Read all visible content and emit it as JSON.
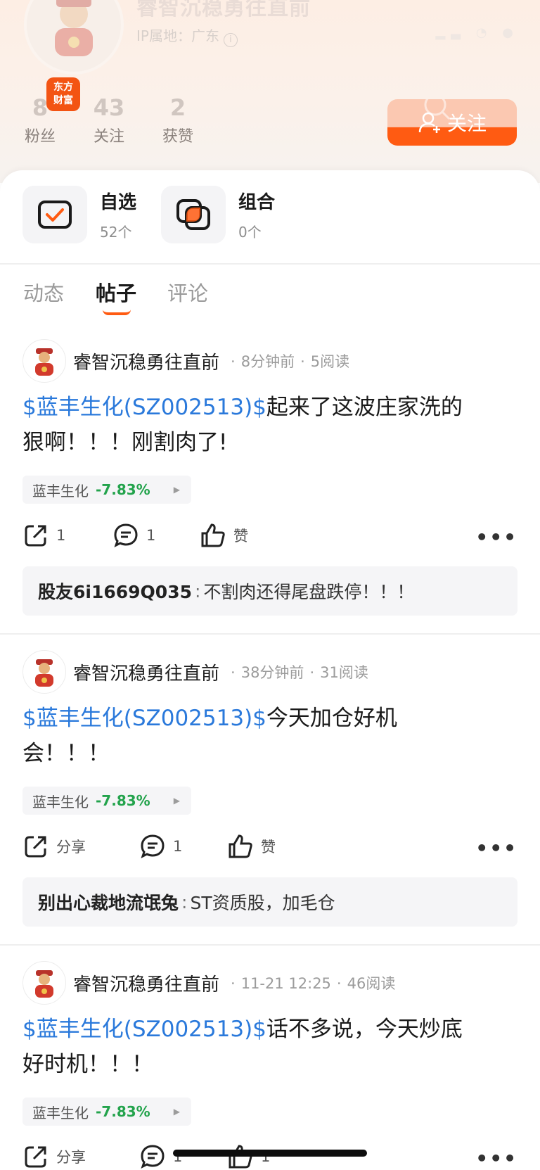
{
  "profile": {
    "name": "睿智沉稳勇往直前",
    "ip_label": "IP属地：广东",
    "info_icon": "ⓘ",
    "brand_badge": [
      "东方",
      "财富"
    ],
    "stats": [
      {
        "num": "8",
        "label": "粉丝"
      },
      {
        "num": "43",
        "label": "关注"
      },
      {
        "num": "2",
        "label": "获赞"
      }
    ],
    "follow_label": "关注"
  },
  "shortcuts": [
    {
      "title": "自选",
      "count": "52个",
      "icon": "checkbox-icon"
    },
    {
      "title": "组合",
      "count": "0个",
      "icon": "portfolio-icon"
    }
  ],
  "tabs": [
    {
      "label": "动态",
      "active": false
    },
    {
      "label": "帖子",
      "active": true
    },
    {
      "label": "评论",
      "active": false
    }
  ],
  "posts": [
    {
      "author": "睿智沉稳勇往直前",
      "time": "8分钟前",
      "reads": "5阅读",
      "tag": "$蓝丰生化(SZ002513)$",
      "text_line1": "起来了这波庄家洗的",
      "text_line2": "狠啊！！！刚割肉了!",
      "stock_name": "蓝丰生化",
      "stock_change": "-7.83%",
      "share": "1",
      "comments": "1",
      "like": "赞",
      "comment_user": "股友6i1669Q035",
      "comment_text": "不割肉还得尾盘跌停！！！"
    },
    {
      "author": "睿智沉稳勇往直前",
      "time": "38分钟前",
      "reads": "31阅读",
      "tag": "$蓝丰生化(SZ002513)$",
      "text_line1": "今天加仓好机",
      "text_line2": "会！！！",
      "stock_name": "蓝丰生化",
      "stock_change": "-7.83%",
      "share": "分享",
      "comments": "1",
      "like": "赞",
      "comment_user": "别出心裁地流氓兔",
      "comment_text": "ST资质股，加毛仓"
    },
    {
      "author": "睿智沉稳勇往直前",
      "time": "11-21 12:25",
      "reads": "46阅读",
      "tag": "$蓝丰生化(SZ002513)$",
      "text_line1": "话不多说，今天炒底",
      "text_line2": "好时机！！！",
      "stock_name": "蓝丰生化",
      "stock_change": "-7.83%",
      "share": "分享",
      "comments": "1",
      "like": "1"
    }
  ],
  "colors": {
    "accent": "#ff5b12",
    "link": "#2a79db",
    "down": "#23a34c"
  }
}
